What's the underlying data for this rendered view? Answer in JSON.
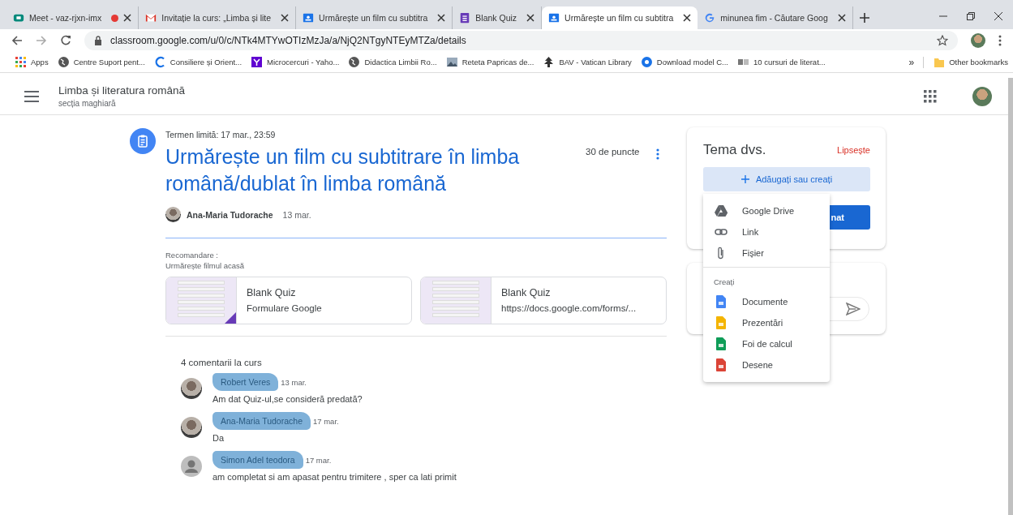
{
  "tabs": [
    {
      "title": "Meet - vaz-rjxn-imx",
      "selected": false,
      "recording": true
    },
    {
      "title": "Invitație la curs: „Limba și lite",
      "selected": false,
      "recording": false
    },
    {
      "title": "Urmărește un film cu subtitra",
      "selected": false,
      "recording": false
    },
    {
      "title": "Blank Quiz",
      "selected": false,
      "recording": false
    },
    {
      "title": "Urmărește un film cu subtitra",
      "selected": true,
      "recording": false
    },
    {
      "title": "minunea fim - Căutare Goog",
      "selected": false,
      "recording": false
    }
  ],
  "address": "classroom.google.com/u/0/c/NTk4MTYwOTIzMzJa/a/NjQ2NTgyNTEyMTZa/details",
  "bookmarks": [
    {
      "label": "Apps"
    },
    {
      "label": "Centre Suport pent..."
    },
    {
      "label": "Consiliere și Orient..."
    },
    {
      "label": "Microcercuri - Yaho..."
    },
    {
      "label": "Didactica Limbii Ro..."
    },
    {
      "label": "Reteta Papricas de..."
    },
    {
      "label": "BAV - Vatican Library"
    },
    {
      "label": "Download model C..."
    },
    {
      "label": "10 cursuri de literat..."
    }
  ],
  "bookmarks_more": "»",
  "other_bookmarks": "Other bookmarks",
  "header": {
    "title": "Limba și literatura română",
    "subtitle": "secția maghiară"
  },
  "assignment": {
    "due": "Termen limită: 17 mar., 23:59",
    "title": "Urmărește un film cu subtitrare în limba română/dublat în limba română",
    "points": "30 de puncte",
    "author": "Ana-Maria Tudorache",
    "date": "13 mar.",
    "description": [
      "Recomandare :",
      "Urmărește filmul acasă"
    ],
    "attachments": [
      {
        "title": "Blank Quiz",
        "subtitle": "Formulare Google"
      },
      {
        "title": "Blank Quiz",
        "subtitle": "https://docs.google.com/forms/..."
      }
    ]
  },
  "comments": {
    "heading": "4 comentarii la curs",
    "items": [
      {
        "author": "Robert Veres",
        "date": "13 mar.",
        "text": "Am dat Quiz-ul,se consideră predată?",
        "kind": "photo",
        "highlighted": true
      },
      {
        "author": "Ana-Maria Tudorache",
        "date": "17 mar.",
        "text": "Da",
        "kind": "photo",
        "highlighted": true
      },
      {
        "author": "Simon Adel teodora",
        "date": "17 mar.",
        "text": "am completat si am apasat pentru trimitere , sper ca lati primit",
        "kind": "default",
        "highlighted": true
      }
    ]
  },
  "work": {
    "title": "Tema dvs.",
    "status": "Lipsește",
    "add_button": "Adăugați sau creați",
    "submit_button": "nat"
  },
  "menu": {
    "items": [
      {
        "label": "Google Drive"
      },
      {
        "label": "Link"
      },
      {
        "label": "Fișier"
      }
    ],
    "section": "Creați",
    "create": [
      {
        "label": "Documente",
        "color": "#4285f4"
      },
      {
        "label": "Prezentări",
        "color": "#f4b400"
      },
      {
        "label": "Foi de calcul",
        "color": "#0f9d58"
      },
      {
        "label": "Desene",
        "color": "#db4437"
      }
    ]
  }
}
